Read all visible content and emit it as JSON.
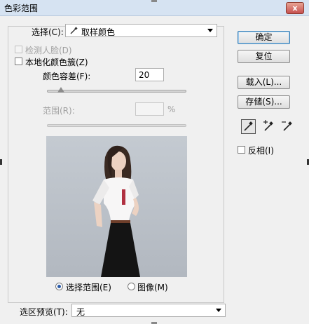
{
  "window": {
    "title": "色彩范围",
    "close_glyph": "x"
  },
  "select": {
    "label": "选择(C):",
    "value": "取样颜色",
    "icon": "eyedropper-icon"
  },
  "detect_faces": {
    "label": "检测人脸(D)",
    "checked": false,
    "enabled": false
  },
  "localized_clusters": {
    "label": "本地化颜色簇(Z)",
    "checked": false
  },
  "fuzziness": {
    "label": "颜色容差(F):",
    "value": "20",
    "slider_fraction": 0.1
  },
  "range": {
    "label": "范围(R):",
    "value": "",
    "unit": "%",
    "enabled": false
  },
  "view_mode": {
    "selection_label": "选择范围(E)",
    "image_label": "图像(M)",
    "selected": "selection"
  },
  "selection_preview": {
    "label": "选区预览(T):",
    "value": "无"
  },
  "buttons": {
    "ok": "确定",
    "reset": "复位",
    "load": "载入(L)...",
    "save": "存储(S)..."
  },
  "tools": [
    "eyedropper-icon",
    "eyedropper-plus-icon",
    "eyedropper-minus-icon"
  ],
  "invert": {
    "label": "反相(I)",
    "checked": false
  },
  "colors": {
    "accent": "#3c7fb1",
    "background": "#f0f0f0",
    "preview_bg": "#b9bfc7"
  }
}
